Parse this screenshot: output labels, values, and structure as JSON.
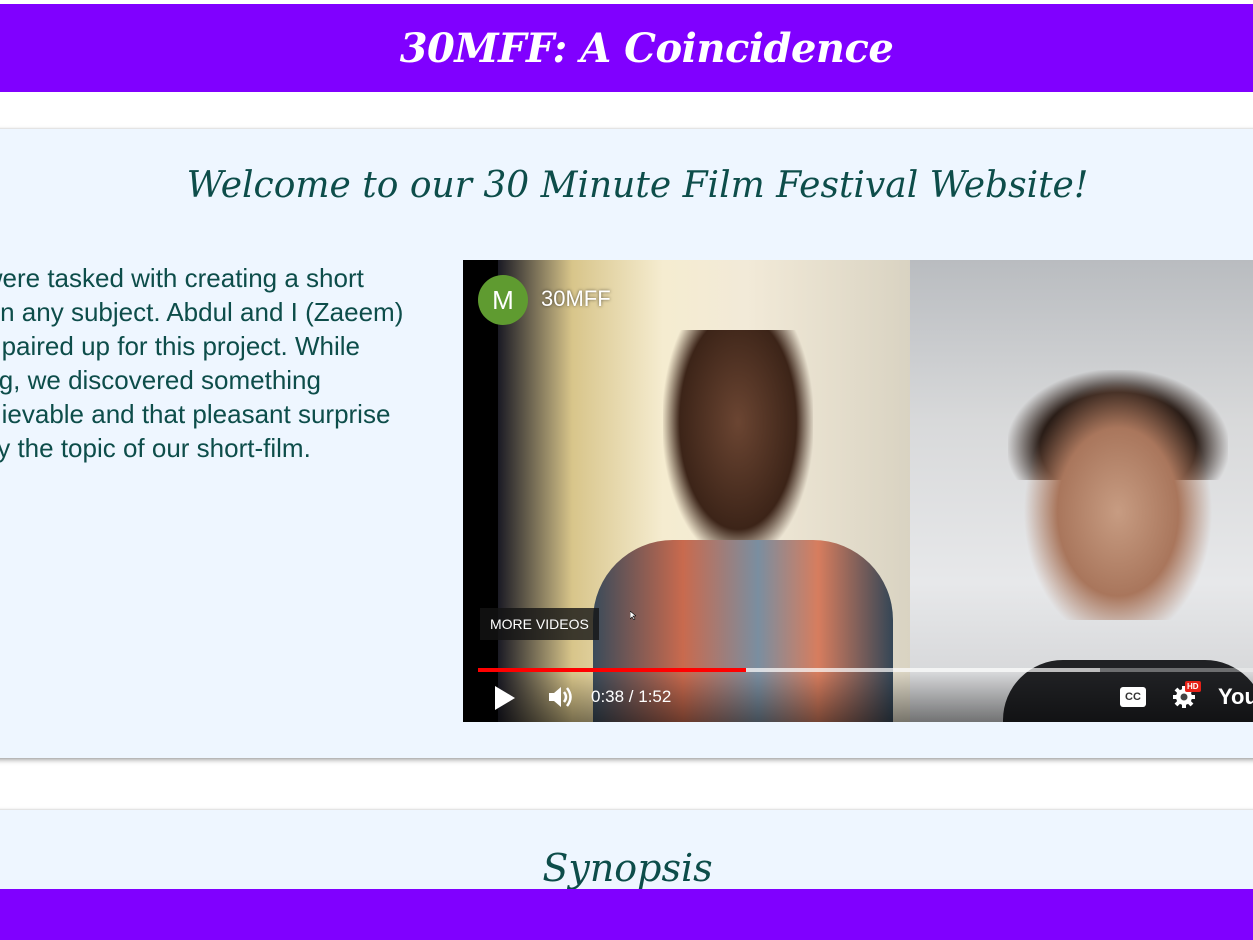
{
  "header": {
    "title": "30MFF: A Coincidence"
  },
  "welcome": {
    "title": "Welcome to our 30 Minute Film Festival Website!",
    "intro_lines": [
      "We were tasked with creating a short",
      "film on any subject. Abdul and I (Zaeem)",
      "were paired up for this project. While",
      "talking, we discovered something",
      "unbelievable and that pleasant surprise",
      "is why the topic of our short-film."
    ]
  },
  "video": {
    "channel_initial": "M",
    "channel_name": "30MFF",
    "more_videos_label": "MORE VIDEOS",
    "time_display": "0:38 / 1:52",
    "progress_fraction": 0.34,
    "buffered_fraction": 0.79,
    "cc_label": "CC",
    "hd_badge": "HD",
    "logo_text": "YouTube",
    "avatar_color": "#5f9b30",
    "progress_color": "#ff0000"
  },
  "synopsis": {
    "title": "Synopsis"
  },
  "colors": {
    "bar": "#8000ff",
    "card_bg": "#eef6ff",
    "heading_text": "#0d4d4a"
  }
}
